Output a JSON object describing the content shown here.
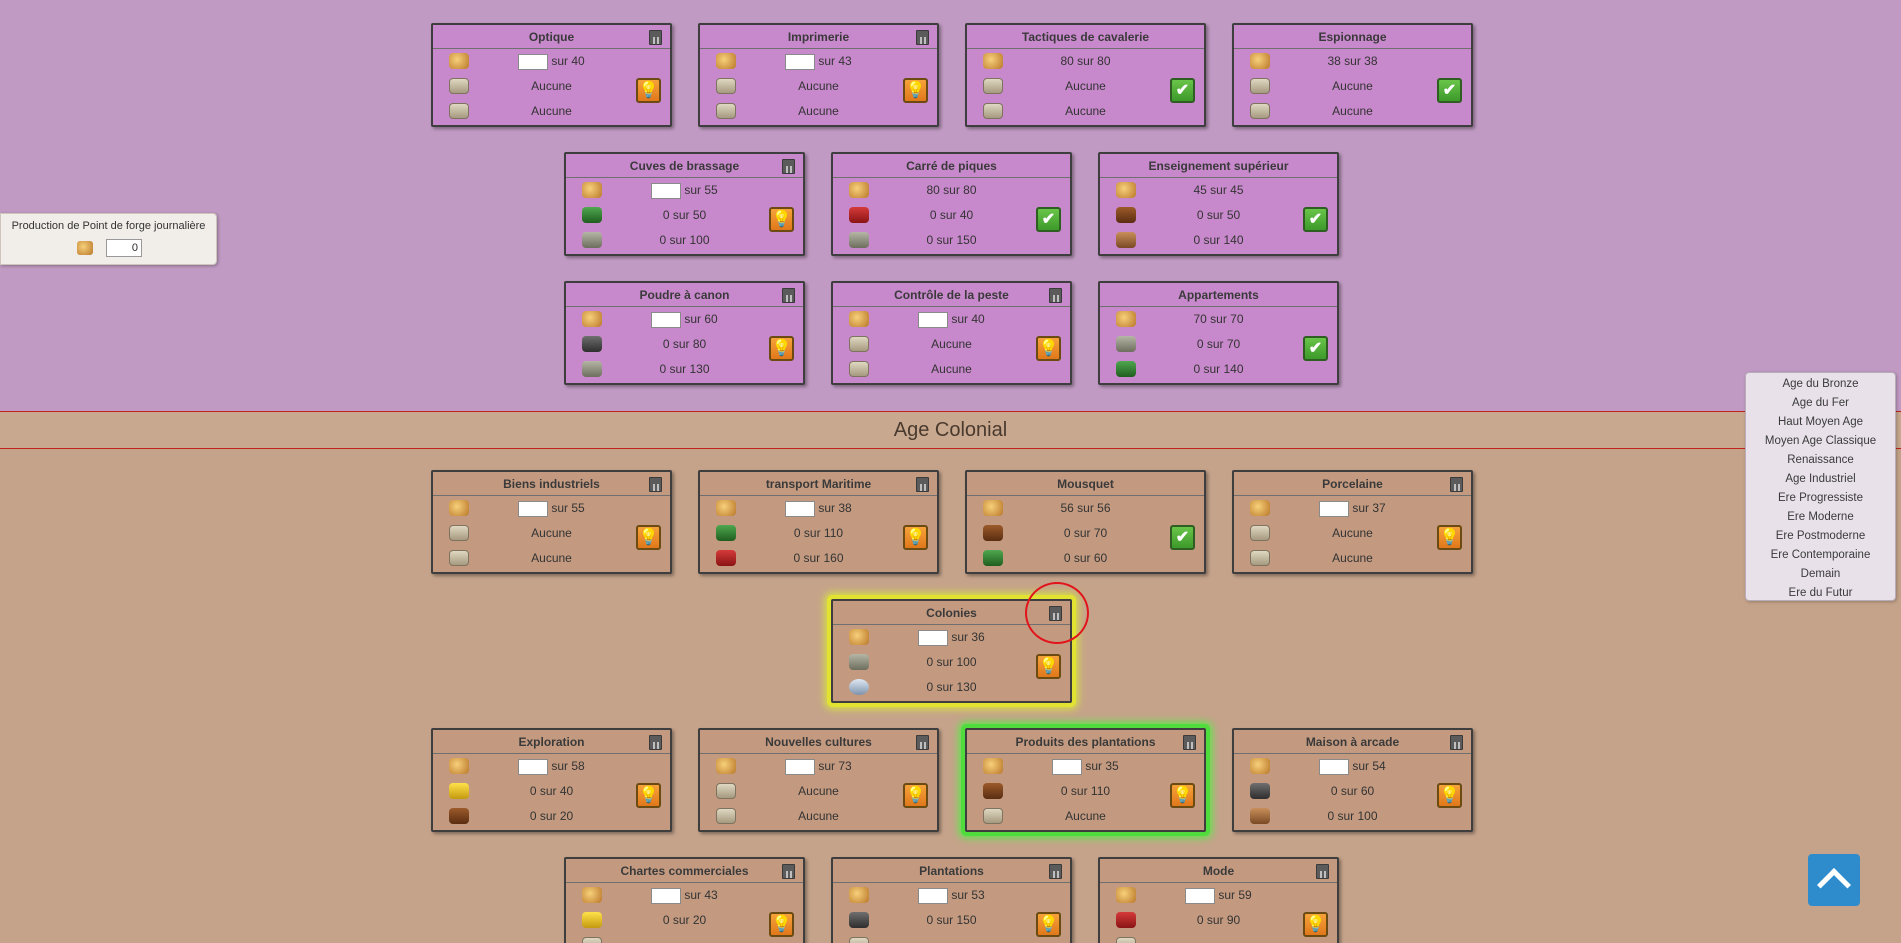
{
  "fp_panel": {
    "label": "Production de Point de forge journalière",
    "value": "0"
  },
  "age_menu": [
    "Age du Bronze",
    "Age du Fer",
    "Haut Moyen Age",
    "Moyen Age Classique",
    "Renaissance",
    "Age Industriel",
    "Ere Progressiste",
    "Ere Moderne",
    "Ere Postmoderne",
    "Ere Contemporaine",
    "Demain",
    "Ere du Futur"
  ],
  "age_title": "Age Colonial",
  "techs": [
    {
      "id": "optique",
      "title": "Optique",
      "era": "purple",
      "calc": true,
      "fp": "sur 40",
      "fp_input": true,
      "r1": {
        "icon": "none",
        "text": "Aucune"
      },
      "r2": {
        "icon": "none",
        "text": "Aucune"
      },
      "status": "bulb"
    },
    {
      "id": "imprimerie",
      "title": "Imprimerie",
      "era": "purple",
      "calc": true,
      "fp": "sur 43",
      "fp_input": true,
      "r1": {
        "icon": "none",
        "text": "Aucune"
      },
      "r2": {
        "icon": "none",
        "text": "Aucune"
      },
      "status": "bulb"
    },
    {
      "id": "tactiques",
      "title": "Tactiques de cavalerie",
      "era": "purple",
      "calc": false,
      "fp": "80 sur 80",
      "fp_input": false,
      "r1": {
        "icon": "none",
        "text": "Aucune"
      },
      "r2": {
        "icon": "none",
        "text": "Aucune"
      },
      "status": "check"
    },
    {
      "id": "espionnage",
      "title": "Espionnage",
      "era": "purple",
      "calc": false,
      "fp": "38 sur 38",
      "fp_input": false,
      "r1": {
        "icon": "none",
        "text": "Aucune"
      },
      "r2": {
        "icon": "none",
        "text": "Aucune"
      },
      "status": "check"
    },
    {
      "id": "cuves",
      "title": "Cuves de brassage",
      "era": "purple",
      "calc": true,
      "fp": "sur 55",
      "fp_input": true,
      "r1": {
        "icon": "green",
        "text": "0 sur 50"
      },
      "r2": {
        "icon": "grey",
        "text": "0 sur 100"
      },
      "status": "bulb"
    },
    {
      "id": "piques",
      "title": "Carré de piques",
      "era": "purple",
      "calc": false,
      "fp": "80 sur 80",
      "fp_input": false,
      "r1": {
        "icon": "red",
        "text": "0 sur 40"
      },
      "r2": {
        "icon": "grey",
        "text": "0 sur 150"
      },
      "status": "check"
    },
    {
      "id": "enseignement",
      "title": "Enseignement supérieur",
      "era": "purple",
      "calc": false,
      "fp": "45 sur 45",
      "fp_input": false,
      "r1": {
        "icon": "brown",
        "text": "0 sur 50"
      },
      "r2": {
        "icon": "plank",
        "text": "0 sur 140"
      },
      "status": "check"
    },
    {
      "id": "poudre",
      "title": "Poudre à canon",
      "era": "purple",
      "calc": true,
      "fp": "sur 60",
      "fp_input": true,
      "r1": {
        "icon": "dark",
        "text": "0 sur 80"
      },
      "r2": {
        "icon": "grey",
        "text": "0 sur 130"
      },
      "status": "bulb"
    },
    {
      "id": "peste",
      "title": "Contrôle de la peste",
      "era": "purple",
      "calc": true,
      "fp": "sur 40",
      "fp_input": true,
      "r1": {
        "icon": "none",
        "text": "Aucune"
      },
      "r2": {
        "icon": "none",
        "text": "Aucune"
      },
      "status": "bulb"
    },
    {
      "id": "appartements",
      "title": "Appartements",
      "era": "purple",
      "calc": false,
      "fp": "70 sur 70",
      "fp_input": false,
      "r1": {
        "icon": "grey",
        "text": "0 sur 70"
      },
      "r2": {
        "icon": "green",
        "text": "0 sur 140"
      },
      "status": "check"
    },
    {
      "id": "biens",
      "title": "Biens industriels",
      "era": "brown",
      "calc": true,
      "fp": "sur 55",
      "fp_input": true,
      "r1": {
        "icon": "none",
        "text": "Aucune"
      },
      "r2": {
        "icon": "none",
        "text": "Aucune"
      },
      "status": "bulb"
    },
    {
      "id": "transport",
      "title": "transport Maritime",
      "era": "brown",
      "calc": true,
      "fp": "sur 38",
      "fp_input": true,
      "r1": {
        "icon": "green",
        "text": "0 sur 110"
      },
      "r2": {
        "icon": "red",
        "text": "0 sur 160"
      },
      "status": "bulb"
    },
    {
      "id": "mousquet",
      "title": "Mousquet",
      "era": "brown",
      "calc": false,
      "fp": "56 sur 56",
      "fp_input": false,
      "r1": {
        "icon": "brown",
        "text": "0 sur 70"
      },
      "r2": {
        "icon": "green",
        "text": "0 sur 60"
      },
      "status": "check"
    },
    {
      "id": "porcelaine",
      "title": "Porcelaine",
      "era": "brown",
      "calc": true,
      "fp": "sur 37",
      "fp_input": true,
      "r1": {
        "icon": "none",
        "text": "Aucune"
      },
      "r2": {
        "icon": "none",
        "text": "Aucune"
      },
      "status": "bulb"
    },
    {
      "id": "colonies",
      "title": "Colonies",
      "era": "brown",
      "calc": true,
      "fp": "sur 36",
      "fp_input": true,
      "r1": {
        "icon": "grey",
        "text": "0 sur 100"
      },
      "r2": {
        "icon": "blue",
        "text": "0 sur 130"
      },
      "status": "bulb",
      "highlight": "yellow"
    },
    {
      "id": "exploration",
      "title": "Exploration",
      "era": "brown",
      "calc": true,
      "fp": "sur 58",
      "fp_input": true,
      "r1": {
        "icon": "gold",
        "text": "0 sur 40"
      },
      "r2": {
        "icon": "brown",
        "text": "0 sur 20"
      },
      "status": "bulb"
    },
    {
      "id": "cultures",
      "title": "Nouvelles cultures",
      "era": "brown",
      "calc": true,
      "fp": "sur 73",
      "fp_input": true,
      "r1": {
        "icon": "none",
        "text": "Aucune"
      },
      "r2": {
        "icon": "none",
        "text": "Aucune"
      },
      "status": "bulb"
    },
    {
      "id": "plantprod",
      "title": "Produits des plantations",
      "era": "brown",
      "calc": true,
      "fp": "sur 35",
      "fp_input": true,
      "r1": {
        "icon": "brown",
        "text": "0 sur 110"
      },
      "r2": {
        "icon": "none",
        "text": "Aucune"
      },
      "status": "bulb",
      "highlight": "green"
    },
    {
      "id": "arcade",
      "title": "Maison à arcade",
      "era": "brown",
      "calc": true,
      "fp": "sur 54",
      "fp_input": true,
      "r1": {
        "icon": "dark",
        "text": "0 sur 60"
      },
      "r2": {
        "icon": "plank",
        "text": "0 sur 100"
      },
      "status": "bulb"
    },
    {
      "id": "chartes",
      "title": "Chartes commerciales",
      "era": "brown",
      "calc": true,
      "fp": "sur 43",
      "fp_input": true,
      "r1": {
        "icon": "gold",
        "text": "0 sur 20"
      },
      "r2": {
        "icon": "none",
        "text": ""
      },
      "status": "bulb"
    },
    {
      "id": "plantations",
      "title": "Plantations",
      "era": "brown",
      "calc": true,
      "fp": "sur 53",
      "fp_input": true,
      "r1": {
        "icon": "dark",
        "text": "0 sur 150"
      },
      "r2": {
        "icon": "none",
        "text": ""
      },
      "status": "bulb"
    },
    {
      "id": "mode",
      "title": "Mode",
      "era": "brown",
      "calc": true,
      "fp": "sur 59",
      "fp_input": true,
      "r1": {
        "icon": "red",
        "text": "0 sur 90"
      },
      "r2": {
        "icon": "none",
        "text": ""
      },
      "status": "bulb"
    }
  ]
}
